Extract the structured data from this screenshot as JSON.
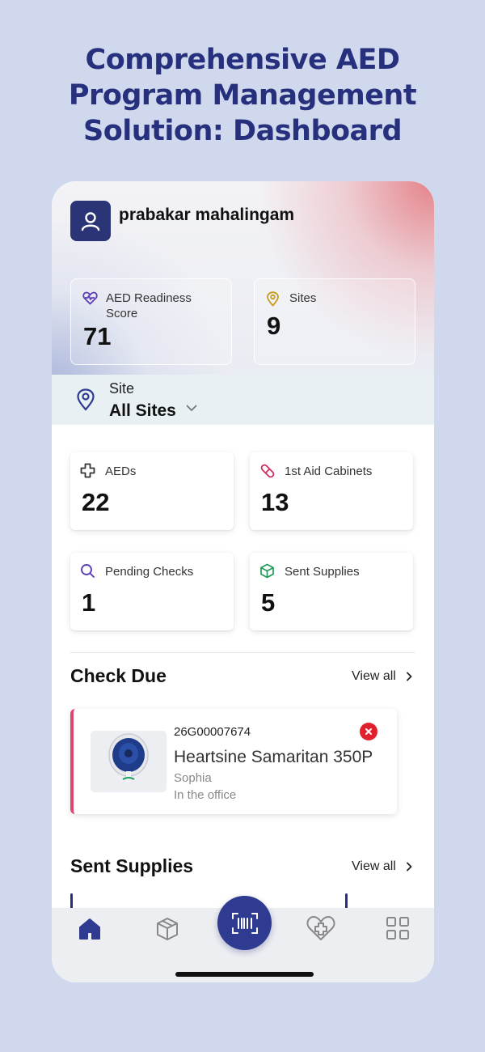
{
  "headline": {
    "line1": "Comprehensive AED",
    "line2": "Program Management",
    "line3": "Solution: Dashboard"
  },
  "user": {
    "name": "prabakar mahalingam",
    "avatar_icon": "user-icon"
  },
  "readiness": {
    "label_line1": "AED Readiness",
    "label_line2": "Score",
    "value": "71",
    "icon": "heartbeat-icon"
  },
  "sites": {
    "label": "Sites",
    "value": "9",
    "icon": "map-pin-icon"
  },
  "site_selector": {
    "label": "Site",
    "value": "All Sites",
    "icon": "map-pin-icon"
  },
  "stats": [
    {
      "label": "AEDs",
      "value": "22",
      "icon": "medical-cross-icon"
    },
    {
      "label": "1st Aid Cabinets",
      "value": "13",
      "icon": "pill-icon"
    },
    {
      "label": "Pending Checks",
      "value": "1",
      "icon": "search-icon"
    },
    {
      "label": "Sent Supplies",
      "value": "5",
      "icon": "package-icon"
    }
  ],
  "check_due": {
    "title": "Check Due",
    "view_all": "View all",
    "item": {
      "serial": "26G00007674",
      "model": "Heartsine Samaritan 350P",
      "person": "Sophia",
      "location": "In the office"
    }
  },
  "sent_supplies": {
    "title": "Sent Supplies",
    "view_all": "View all"
  },
  "tabbar": [
    "home-icon",
    "box-icon",
    "barcode-scan-icon",
    "heart-plus-icon",
    "grid-icon"
  ],
  "colors": {
    "brand": "#27307c",
    "accent_red": "#e0202c",
    "check_due_border": "#e0466d",
    "background": "#cfd8ec"
  }
}
